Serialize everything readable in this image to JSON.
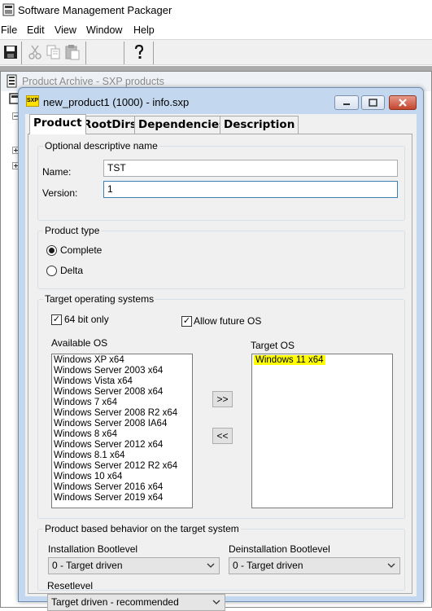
{
  "app": {
    "title": "Software Management Packager"
  },
  "menu": [
    "File",
    "Edit",
    "View",
    "Window",
    "Help"
  ],
  "archive": {
    "title": "Product Archive - SXP products"
  },
  "dialog": {
    "icon_text": "SXP",
    "title": "new_product1 (1000) - info.sxp",
    "tabs": [
      "Product",
      "RootDirs",
      "Dependencies",
      "Description"
    ],
    "descriptive": {
      "group_label": "Optional descriptive name",
      "name_label": "Name:",
      "name_value": "TST",
      "version_label": "Version:",
      "version_value": "1"
    },
    "product_type": {
      "group_label": "Product type",
      "options": [
        "Complete",
        "Delta"
      ],
      "selected": "Complete"
    },
    "target_os": {
      "group_label": "Target operating systems",
      "bit64_label": "64 bit only",
      "bit64_checked": true,
      "future_label": "Allow future OS",
      "future_checked": true,
      "available_label": "Available OS",
      "available": [
        "Windows XP x64",
        "Windows Server 2003 x64",
        "Windows Vista x64",
        "Windows Server 2008 x64",
        "Windows 7 x64",
        "Windows Server 2008 R2 x64",
        "Windows Server 2008 IA64",
        "Windows 8 x64",
        "Windows Server 2012 x64",
        "Windows 8.1 x64",
        "Windows Server 2012 R2 x64",
        "Windows 10 x64",
        "Windows Server 2016 x64",
        "Windows Server 2019 x64"
      ],
      "target_label": "Target OS",
      "target": [
        "Windows 11 x64"
      ],
      "add_button": ">>",
      "remove_button": "<<",
      "highlight_color": "#ffff00"
    },
    "behavior": {
      "group_label": "Product based  behavior on the target system",
      "install_label": "Installation Bootlevel",
      "install_value": "0 - Target driven",
      "deinstall_label": "Deinstallation Bootlevel",
      "deinstall_value": "0 - Target driven",
      "reset_label": "Resetlevel",
      "reset_value": "Target driven - recommended"
    }
  }
}
